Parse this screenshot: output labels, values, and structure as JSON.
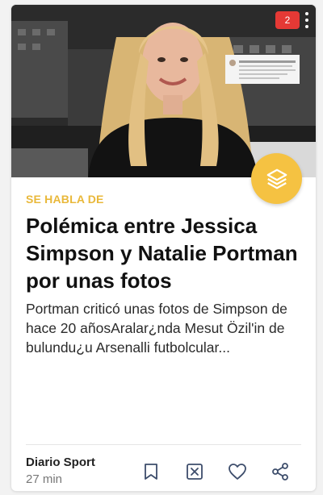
{
  "card": {
    "counter_badge": "2",
    "kicker": "SE HABLA DE",
    "headline": "Polémica entre Jessica Simpson y Natalie Portman por unas fotos",
    "snippet": "Portman criticó unas fotos de Simpson de hace 20 añosAralar¿nda Mesut Özil'in de bulundu¿u Arsenalli futbolcular...",
    "source": "Diario Sport",
    "time": "27 min"
  },
  "icons": {
    "menu": "more-vert-icon",
    "layers": "layers-icon",
    "bookmark": "bookmark-icon",
    "dismiss": "close-icon",
    "like": "heart-icon",
    "share": "share-icon"
  },
  "colors": {
    "accent": "#f5c242",
    "kicker": "#e9b83a",
    "badge": "#e53935",
    "icons": "#3d4d6b"
  }
}
